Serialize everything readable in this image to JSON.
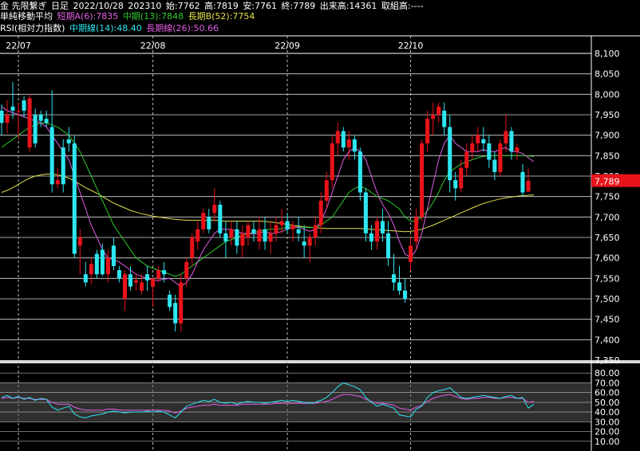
{
  "header": {
    "instrument": "金 先限繋ぎ",
    "period": "日足",
    "date": "2022/10/28",
    "contract": "202310",
    "open": "始:7762",
    "high": "高:7819",
    "low": "安:7761",
    "close": "終:7789",
    "volume": "出来高:14361",
    "open_interest": "取組高:----"
  },
  "legend_ma": {
    "label": "単純移動平均",
    "short": "短期A(6):7835",
    "mid": "中期(13):7848",
    "long": "長期B(52):7754"
  },
  "legend_rsi": {
    "label": "RSI(相対力指数)",
    "mid": "中期線(14):48.40",
    "long": "長期線(26):50.66"
  },
  "current_price_label": "7,789",
  "colors": {
    "up": "#e8131b",
    "down": "#2ee6f0",
    "ma_short": "#e25fe6",
    "ma_mid": "#2dcc2d",
    "ma_long": "#e2e04a",
    "rsi_mid": "#2ee6f0",
    "rsi_long": "#e25fe6",
    "price_tag": "#e8131b",
    "grid": "#ffffff",
    "band": "#555555"
  },
  "chart_data": [
    {
      "type": "candlestick",
      "x_labels": [
        "22/07",
        "22/08",
        "22/09",
        "22/10"
      ],
      "y_ticks": [
        "8,100",
        "8,050",
        "8,000",
        "7,950",
        "7,900",
        "7,850",
        "7,800",
        "7,750",
        "7,700",
        "7,650",
        "7,600",
        "7,550",
        "7,500",
        "7,450",
        "7,400",
        "7,350"
      ],
      "ylim": [
        7350,
        8100
      ],
      "candles": [
        [
          7960,
          7975,
          7900,
          7930
        ],
        [
          7930,
          7985,
          7905,
          7950
        ],
        [
          7970,
          8030,
          7940,
          7960
        ],
        [
          7960,
          7980,
          7890,
          7960
        ],
        [
          7985,
          7995,
          7945,
          7960
        ],
        [
          7870,
          8000,
          7860,
          7990
        ],
        [
          7950,
          7965,
          7870,
          7880
        ],
        [
          7950,
          7960,
          7920,
          7935
        ],
        [
          7940,
          7960,
          7920,
          7930
        ],
        [
          7920,
          8010,
          7760,
          7780
        ],
        [
          7780,
          7820,
          7770,
          7790
        ],
        [
          7870,
          7890,
          7760,
          7780
        ],
        [
          7890,
          7920,
          7860,
          7880
        ],
        [
          7880,
          7900,
          7600,
          7610
        ],
        [
          7630,
          7670,
          7560,
          7650
        ],
        [
          7560,
          7590,
          7530,
          7540
        ],
        [
          7560,
          7600,
          7535,
          7585
        ],
        [
          7610,
          7620,
          7550,
          7560
        ],
        [
          7620,
          7635,
          7555,
          7560
        ],
        [
          7560,
          7620,
          7540,
          7600
        ],
        [
          7630,
          7650,
          7570,
          7580
        ],
        [
          7570,
          7580,
          7540,
          7550
        ],
        [
          7500,
          7570,
          7470,
          7560
        ],
        [
          7560,
          7580,
          7520,
          7530
        ],
        [
          7540,
          7560,
          7520,
          7545
        ],
        [
          7520,
          7560,
          7510,
          7540
        ],
        [
          7560,
          7580,
          7520,
          7545
        ],
        [
          7530,
          7540,
          7480,
          7550
        ],
        [
          7550,
          7580,
          7540,
          7570
        ],
        [
          7570,
          7590,
          7540,
          7560
        ],
        [
          7510,
          7520,
          7470,
          7480
        ],
        [
          7490,
          7510,
          7420,
          7440
        ],
        [
          7440,
          7560,
          7420,
          7540
        ],
        [
          7550,
          7600,
          7530,
          7590
        ],
        [
          7600,
          7660,
          7580,
          7650
        ],
        [
          7640,
          7690,
          7620,
          7670
        ],
        [
          7670,
          7720,
          7660,
          7710
        ],
        [
          7700,
          7720,
          7660,
          7670
        ],
        [
          7710,
          7770,
          7690,
          7730
        ],
        [
          7730,
          7740,
          7650,
          7660
        ],
        [
          7660,
          7690,
          7600,
          7640
        ],
        [
          7650,
          7690,
          7630,
          7670
        ],
        [
          7670,
          7690,
          7610,
          7630
        ],
        [
          7630,
          7680,
          7600,
          7660
        ],
        [
          7650,
          7690,
          7630,
          7680
        ],
        [
          7670,
          7690,
          7640,
          7660
        ],
        [
          7640,
          7700,
          7620,
          7670
        ],
        [
          7670,
          7700,
          7620,
          7640
        ],
        [
          7640,
          7690,
          7610,
          7660
        ],
        [
          7660,
          7700,
          7640,
          7680
        ],
        [
          7680,
          7720,
          7660,
          7690
        ],
        [
          7690,
          7710,
          7660,
          7670
        ],
        [
          7670,
          7690,
          7640,
          7680
        ],
        [
          7670,
          7700,
          7640,
          7660
        ],
        [
          7640,
          7680,
          7600,
          7630
        ],
        [
          7630,
          7660,
          7590,
          7650
        ],
        [
          7650,
          7700,
          7630,
          7680
        ],
        [
          7680,
          7760,
          7660,
          7740
        ],
        [
          7740,
          7810,
          7720,
          7790
        ],
        [
          7790,
          7900,
          7770,
          7880
        ],
        [
          7880,
          7930,
          7850,
          7910
        ],
        [
          7910,
          7920,
          7860,
          7870
        ],
        [
          7870,
          7910,
          7840,
          7890
        ],
        [
          7890,
          7900,
          7840,
          7860
        ],
        [
          7860,
          7870,
          7740,
          7760
        ],
        [
          7760,
          7770,
          7640,
          7660
        ],
        [
          7660,
          7680,
          7620,
          7640
        ],
        [
          7640,
          7700,
          7620,
          7690
        ],
        [
          7690,
          7720,
          7640,
          7660
        ],
        [
          7660,
          7690,
          7580,
          7600
        ],
        [
          7560,
          7610,
          7520,
          7540
        ],
        [
          7540,
          7580,
          7510,
          7520
        ],
        [
          7520,
          7550,
          7490,
          7500
        ],
        [
          7590,
          7650,
          7570,
          7630
        ],
        [
          7640,
          7720,
          7620,
          7700
        ],
        [
          7700,
          7890,
          7690,
          7880
        ],
        [
          7880,
          7960,
          7860,
          7940
        ],
        [
          7940,
          7980,
          7900,
          7950
        ],
        [
          7950,
          7980,
          7930,
          7970
        ],
        [
          7960,
          7980,
          7900,
          7920
        ],
        [
          7920,
          7950,
          7760,
          7790
        ],
        [
          7790,
          7810,
          7740,
          7770
        ],
        [
          7770,
          7840,
          7760,
          7820
        ],
        [
          7820,
          7880,
          7800,
          7860
        ],
        [
          7860,
          7900,
          7840,
          7880
        ],
        [
          7880,
          7920,
          7860,
          7900
        ],
        [
          7890,
          7920,
          7860,
          7880
        ],
        [
          7880,
          7900,
          7820,
          7840
        ],
        [
          7840,
          7860,
          7790,
          7810
        ],
        [
          7810,
          7890,
          7800,
          7880
        ],
        [
          7880,
          7950,
          7860,
          7910
        ],
        [
          7910,
          7920,
          7840,
          7860
        ],
        [
          7860,
          7880,
          7840,
          7870
        ],
        [
          7810,
          7830,
          7750,
          7760
        ],
        [
          7762,
          7819,
          7761,
          7789
        ]
      ],
      "ma_short": [
        7970,
        7960,
        7955,
        7950,
        7945,
        7940,
        7935,
        7930,
        7920,
        7900,
        7880,
        7860,
        7840,
        7800,
        7760,
        7720,
        7680,
        7650,
        7620,
        7600,
        7595,
        7590,
        7580,
        7570,
        7560,
        7555,
        7550,
        7545,
        7545,
        7548,
        7550,
        7540,
        7530,
        7540,
        7560,
        7590,
        7620,
        7640,
        7660,
        7670,
        7670,
        7670,
        7665,
        7660,
        7660,
        7658,
        7660,
        7665,
        7660,
        7660,
        7665,
        7670,
        7675,
        7675,
        7670,
        7665,
        7670,
        7690,
        7720,
        7760,
        7800,
        7840,
        7860,
        7870,
        7860,
        7840,
        7800,
        7760,
        7730,
        7710,
        7680,
        7640,
        7610,
        7600,
        7620,
        7660,
        7720,
        7780,
        7840,
        7880,
        7900,
        7880,
        7870,
        7860,
        7860,
        7860,
        7865,
        7860,
        7860,
        7865,
        7870,
        7860,
        7860,
        7855,
        7845,
        7835
      ],
      "ma_mid": [
        7870,
        7880,
        7890,
        7900,
        7910,
        7920,
        7925,
        7930,
        7930,
        7925,
        7920,
        7910,
        7900,
        7880,
        7860,
        7830,
        7800,
        7770,
        7740,
        7710,
        7680,
        7660,
        7640,
        7620,
        7600,
        7590,
        7580,
        7575,
        7570,
        7565,
        7560,
        7555,
        7560,
        7570,
        7580,
        7590,
        7600,
        7610,
        7620,
        7630,
        7640,
        7645,
        7650,
        7655,
        7660,
        7662,
        7665,
        7668,
        7670,
        7670,
        7672,
        7675,
        7676,
        7676,
        7675,
        7674,
        7675,
        7680,
        7690,
        7700,
        7720,
        7740,
        7760,
        7770,
        7775,
        7770,
        7760,
        7750,
        7745,
        7740,
        7730,
        7720,
        7700,
        7690,
        7690,
        7700,
        7715,
        7735,
        7760,
        7790,
        7810,
        7820,
        7830,
        7835,
        7840,
        7845,
        7848,
        7850,
        7850,
        7850,
        7850,
        7850,
        7850,
        7850,
        7849,
        7848
      ],
      "ma_long": [
        7760,
        7765,
        7772,
        7780,
        7788,
        7795,
        7800,
        7803,
        7805,
        7805,
        7803,
        7800,
        7795,
        7788,
        7780,
        7772,
        7765,
        7758,
        7750,
        7742,
        7734,
        7728,
        7722,
        7716,
        7712,
        7708,
        7705,
        7702,
        7700,
        7698,
        7696,
        7694,
        7693,
        7692,
        7692,
        7692,
        7692,
        7692,
        7692,
        7691,
        7690,
        7690,
        7690,
        7690,
        7690,
        7690,
        7690,
        7689,
        7688,
        7686,
        7684,
        7682,
        7680,
        7678,
        7676,
        7675,
        7674,
        7673,
        7672,
        7672,
        7672,
        7672,
        7672,
        7672,
        7672,
        7671,
        7670,
        7669,
        7668,
        7667,
        7666,
        7665,
        7664,
        7665,
        7667,
        7670,
        7675,
        7680,
        7686,
        7692,
        7698,
        7704,
        7710,
        7716,
        7722,
        7728,
        7733,
        7737,
        7741,
        7744,
        7747,
        7749,
        7751,
        7752,
        7753,
        7754
      ]
    },
    {
      "type": "line",
      "title": "RSI",
      "y_ticks": [
        "80.00",
        "70.00",
        "60.00",
        "50.00",
        "40.00",
        "30.00",
        "20.00",
        "10.00"
      ],
      "ylim": [
        0,
        90
      ],
      "band": [
        30,
        70
      ],
      "series": [
        {
          "name": "中期線(14)",
          "values": [
            55,
            57,
            54,
            56,
            53,
            55,
            52,
            54,
            53,
            45,
            42,
            44,
            46,
            38,
            35,
            34,
            36,
            37,
            38,
            40,
            41,
            40,
            39,
            40,
            40,
            40,
            41,
            40,
            41,
            40,
            37,
            34,
            40,
            46,
            48,
            50,
            52,
            51,
            53,
            50,
            49,
            50,
            48,
            50,
            51,
            50,
            50,
            49,
            50,
            51,
            52,
            51,
            52,
            51,
            50,
            49,
            50,
            52,
            55,
            60,
            66,
            70,
            68,
            66,
            63,
            55,
            50,
            46,
            48,
            46,
            44,
            37,
            36,
            35,
            43,
            46,
            55,
            60,
            62,
            63,
            65,
            60,
            55,
            54,
            55,
            56,
            57,
            56,
            55,
            54,
            56,
            57,
            54,
            55,
            44,
            48
          ]
        },
        {
          "name": "長期線(26)",
          "values": [
            54,
            55,
            54,
            55,
            54,
            54,
            53,
            53,
            53,
            50,
            48,
            48,
            48,
            45,
            43,
            42,
            42,
            42,
            42,
            43,
            43,
            42,
            42,
            42,
            42,
            42,
            42,
            42,
            42,
            42,
            41,
            39,
            41,
            44,
            45,
            46,
            47,
            47,
            48,
            47,
            47,
            47,
            47,
            48,
            48,
            48,
            48,
            48,
            48,
            49,
            49,
            49,
            49,
            49,
            49,
            49,
            49,
            50,
            51,
            53,
            56,
            58,
            58,
            57,
            56,
            53,
            51,
            49,
            49,
            48,
            47,
            44,
            43,
            42,
            45,
            47,
            51,
            54,
            56,
            57,
            58,
            56,
            54,
            53,
            54,
            54,
            55,
            55,
            54,
            54,
            55,
            55,
            54,
            54,
            50,
            51
          ]
        }
      ]
    }
  ]
}
